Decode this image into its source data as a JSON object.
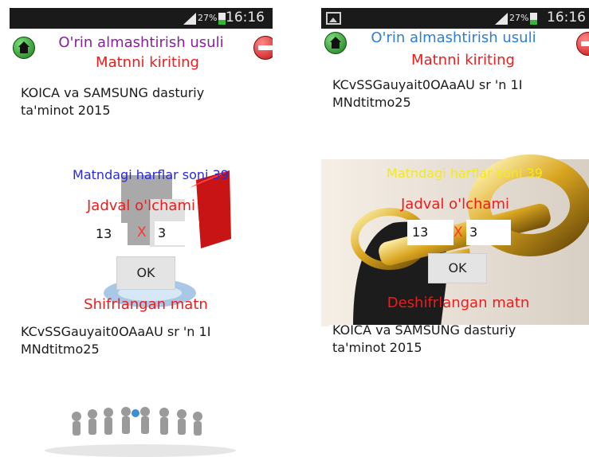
{
  "status_bar": {
    "battery_percent": "27%",
    "time": "16:16"
  },
  "colors": {
    "title_purple": "#8a1fa0",
    "title_blue": "#2d7fd6",
    "red_text": "#ee1c1c",
    "letters_blue": "#2a2ad8",
    "letters_yellow": "#f2ea1e"
  },
  "encrypt_screen": {
    "title": "O'rin almashtirish usuli",
    "input_label": "Matnni kiriting",
    "input_text": "KOICA va SAMSUNG dasturiy\nta'minot 2015",
    "letter_count_label": "Matndagi harflar soni 39",
    "table_size_label": "Jadval o'lchami",
    "rows_value": "13",
    "times_symbol": "X",
    "cols_value": "3",
    "ok_label": "OK",
    "output_label": "Shifrlangan matn",
    "output_text": "KCvSSGauyait0OAaAU sr 'n 1I\nMNdtitmo25"
  },
  "decrypt_screen": {
    "title": "O'rin almashtirish usuli",
    "input_label": "Matnni kiriting",
    "input_text": "KCvSSGauyait0OAaAU sr 'n 1I\nMNdtitmo25",
    "letter_count_label": "Matndagi harflar soni 39",
    "table_size_label": "Jadval o'lchami",
    "rows_value": "13",
    "times_symbol": "X",
    "cols_value": "3",
    "ok_label": "OK",
    "output_label": "Deshifrlangan matn",
    "output_text": "KOICA va SAMSUNG dasturiy\nta'minot 2015"
  }
}
